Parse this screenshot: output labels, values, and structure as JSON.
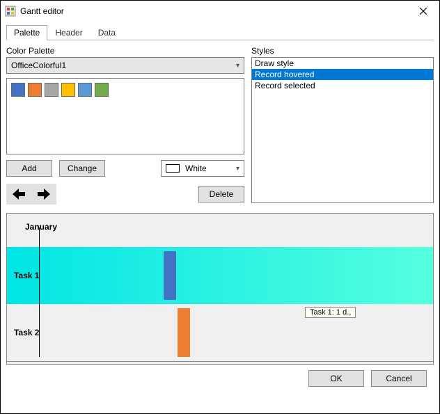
{
  "window": {
    "title": "Gantt editor"
  },
  "tabs": [
    "Palette",
    "Header",
    "Data"
  ],
  "active_tab": 0,
  "palette": {
    "color_palette_label": "Color Palette",
    "combo_value": "OfficeColorful1",
    "swatches": [
      "#4472c4",
      "#ed7d31",
      "#a5a5a5",
      "#ffc000",
      "#5b9bd5",
      "#70ad47"
    ],
    "add_label": "Add",
    "change_label": "Change",
    "color_select_value": "White",
    "color_select_hex": "#ffffff",
    "delete_label": "Delete"
  },
  "styles": {
    "label": "Styles",
    "items": [
      "Draw style",
      "Record hovered",
      "Record selected"
    ],
    "selected_index": 1
  },
  "gantt": {
    "month": "January",
    "rows": [
      {
        "label": "Task 1",
        "bar_color": "#4472c4"
      },
      {
        "label": "Task 2",
        "bar_color": "#ed7d31"
      }
    ],
    "tooltip": "Task 1: 1 d.,"
  },
  "footer": {
    "ok": "OK",
    "cancel": "Cancel"
  }
}
